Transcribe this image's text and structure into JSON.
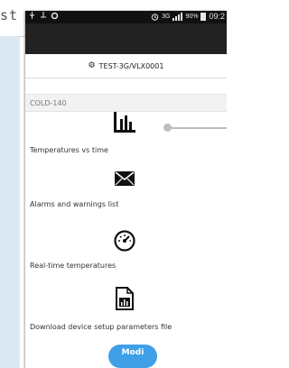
{
  "background": {
    "partial_word": "st"
  },
  "status_bar": {
    "time": "09:2",
    "battery": "90%",
    "network": "3G"
  },
  "device": {
    "name": "TEST-3G/VLX0001",
    "section": "COLD-140"
  },
  "menu": [
    {
      "label": "Temperatures vs time",
      "icon": "bar-chart-icon"
    },
    {
      "label": "Alarms and warnings list",
      "icon": "envelope-icon"
    },
    {
      "label": "Real-time temperatures",
      "icon": "speedometer-icon"
    },
    {
      "label": "Download device setup parameters file",
      "icon": "document-chart-icon"
    }
  ],
  "bottom_button": {
    "label": "Modi"
  },
  "colors": {
    "accent": "#3f9fe7",
    "app_bar": "#222222",
    "status_bar": "#111111"
  }
}
